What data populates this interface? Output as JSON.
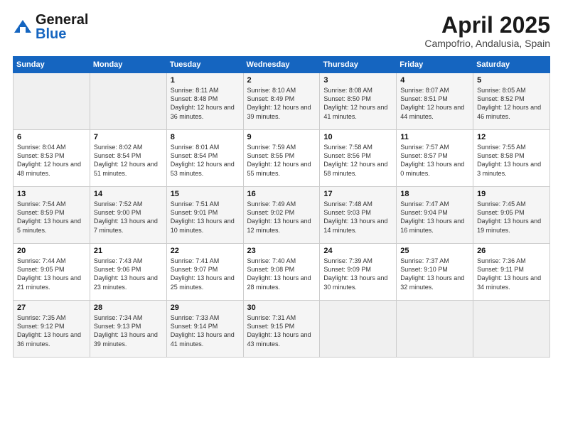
{
  "header": {
    "logo_general": "General",
    "logo_blue": "Blue",
    "title": "April 2025",
    "subtitle": "Campofrio, Andalusia, Spain"
  },
  "weekdays": [
    "Sunday",
    "Monday",
    "Tuesday",
    "Wednesday",
    "Thursday",
    "Friday",
    "Saturday"
  ],
  "weeks": [
    [
      {
        "day": "",
        "info": ""
      },
      {
        "day": "",
        "info": ""
      },
      {
        "day": "1",
        "info": "Sunrise: 8:11 AM\nSunset: 8:48 PM\nDaylight: 12 hours and 36 minutes."
      },
      {
        "day": "2",
        "info": "Sunrise: 8:10 AM\nSunset: 8:49 PM\nDaylight: 12 hours and 39 minutes."
      },
      {
        "day": "3",
        "info": "Sunrise: 8:08 AM\nSunset: 8:50 PM\nDaylight: 12 hours and 41 minutes."
      },
      {
        "day": "4",
        "info": "Sunrise: 8:07 AM\nSunset: 8:51 PM\nDaylight: 12 hours and 44 minutes."
      },
      {
        "day": "5",
        "info": "Sunrise: 8:05 AM\nSunset: 8:52 PM\nDaylight: 12 hours and 46 minutes."
      }
    ],
    [
      {
        "day": "6",
        "info": "Sunrise: 8:04 AM\nSunset: 8:53 PM\nDaylight: 12 hours and 48 minutes."
      },
      {
        "day": "7",
        "info": "Sunrise: 8:02 AM\nSunset: 8:54 PM\nDaylight: 12 hours and 51 minutes."
      },
      {
        "day": "8",
        "info": "Sunrise: 8:01 AM\nSunset: 8:54 PM\nDaylight: 12 hours and 53 minutes."
      },
      {
        "day": "9",
        "info": "Sunrise: 7:59 AM\nSunset: 8:55 PM\nDaylight: 12 hours and 55 minutes."
      },
      {
        "day": "10",
        "info": "Sunrise: 7:58 AM\nSunset: 8:56 PM\nDaylight: 12 hours and 58 minutes."
      },
      {
        "day": "11",
        "info": "Sunrise: 7:57 AM\nSunset: 8:57 PM\nDaylight: 13 hours and 0 minutes."
      },
      {
        "day": "12",
        "info": "Sunrise: 7:55 AM\nSunset: 8:58 PM\nDaylight: 13 hours and 3 minutes."
      }
    ],
    [
      {
        "day": "13",
        "info": "Sunrise: 7:54 AM\nSunset: 8:59 PM\nDaylight: 13 hours and 5 minutes."
      },
      {
        "day": "14",
        "info": "Sunrise: 7:52 AM\nSunset: 9:00 PM\nDaylight: 13 hours and 7 minutes."
      },
      {
        "day": "15",
        "info": "Sunrise: 7:51 AM\nSunset: 9:01 PM\nDaylight: 13 hours and 10 minutes."
      },
      {
        "day": "16",
        "info": "Sunrise: 7:49 AM\nSunset: 9:02 PM\nDaylight: 13 hours and 12 minutes."
      },
      {
        "day": "17",
        "info": "Sunrise: 7:48 AM\nSunset: 9:03 PM\nDaylight: 13 hours and 14 minutes."
      },
      {
        "day": "18",
        "info": "Sunrise: 7:47 AM\nSunset: 9:04 PM\nDaylight: 13 hours and 16 minutes."
      },
      {
        "day": "19",
        "info": "Sunrise: 7:45 AM\nSunset: 9:05 PM\nDaylight: 13 hours and 19 minutes."
      }
    ],
    [
      {
        "day": "20",
        "info": "Sunrise: 7:44 AM\nSunset: 9:05 PM\nDaylight: 13 hours and 21 minutes."
      },
      {
        "day": "21",
        "info": "Sunrise: 7:43 AM\nSunset: 9:06 PM\nDaylight: 13 hours and 23 minutes."
      },
      {
        "day": "22",
        "info": "Sunrise: 7:41 AM\nSunset: 9:07 PM\nDaylight: 13 hours and 25 minutes."
      },
      {
        "day": "23",
        "info": "Sunrise: 7:40 AM\nSunset: 9:08 PM\nDaylight: 13 hours and 28 minutes."
      },
      {
        "day": "24",
        "info": "Sunrise: 7:39 AM\nSunset: 9:09 PM\nDaylight: 13 hours and 30 minutes."
      },
      {
        "day": "25",
        "info": "Sunrise: 7:37 AM\nSunset: 9:10 PM\nDaylight: 13 hours and 32 minutes."
      },
      {
        "day": "26",
        "info": "Sunrise: 7:36 AM\nSunset: 9:11 PM\nDaylight: 13 hours and 34 minutes."
      }
    ],
    [
      {
        "day": "27",
        "info": "Sunrise: 7:35 AM\nSunset: 9:12 PM\nDaylight: 13 hours and 36 minutes."
      },
      {
        "day": "28",
        "info": "Sunrise: 7:34 AM\nSunset: 9:13 PM\nDaylight: 13 hours and 39 minutes."
      },
      {
        "day": "29",
        "info": "Sunrise: 7:33 AM\nSunset: 9:14 PM\nDaylight: 13 hours and 41 minutes."
      },
      {
        "day": "30",
        "info": "Sunrise: 7:31 AM\nSunset: 9:15 PM\nDaylight: 13 hours and 43 minutes."
      },
      {
        "day": "",
        "info": ""
      },
      {
        "day": "",
        "info": ""
      },
      {
        "day": "",
        "info": ""
      }
    ]
  ]
}
